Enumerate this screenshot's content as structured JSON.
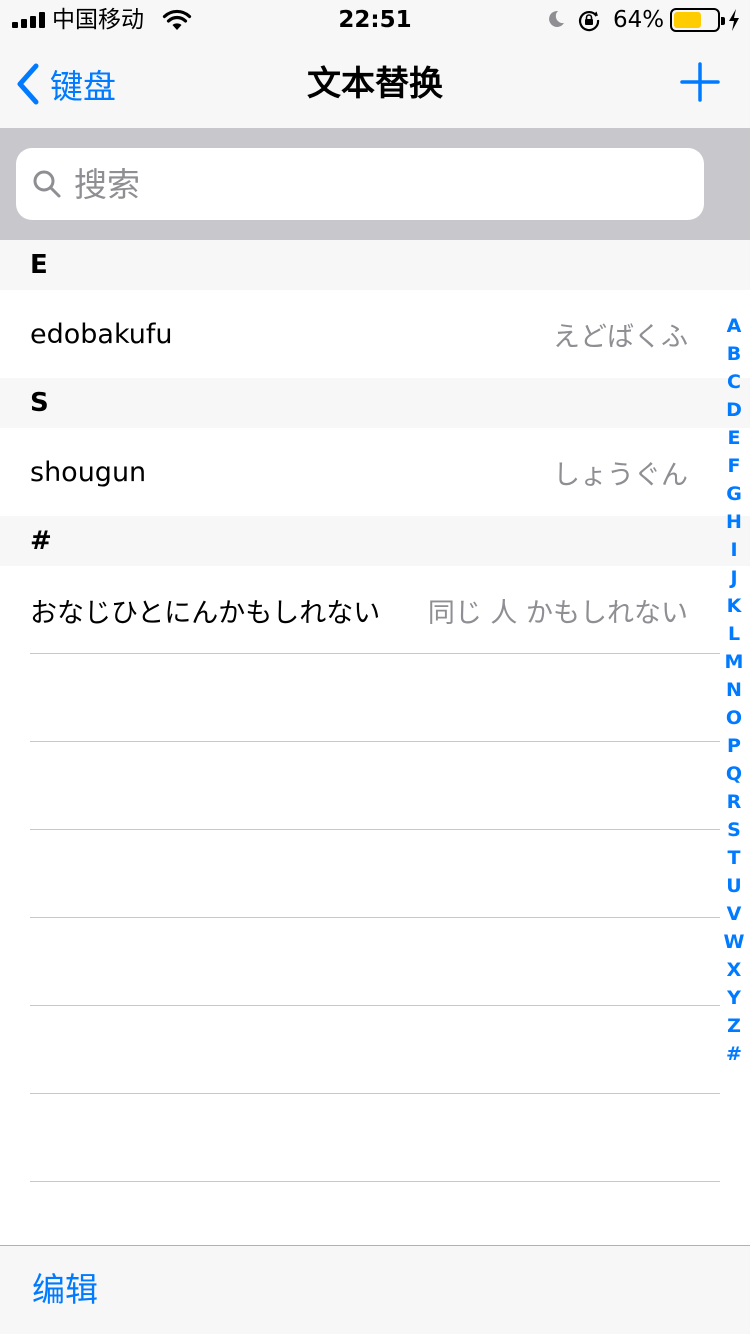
{
  "status_bar": {
    "carrier": "中国移动",
    "time": "22:51",
    "battery_percent": "64%",
    "battery_level": 0.64,
    "icons": [
      "signal-icon",
      "wifi-icon",
      "moon-icon",
      "orientation-lock-icon",
      "battery-icon",
      "charging-bolt-icon"
    ]
  },
  "nav": {
    "back_label": "键盘",
    "title": "文本替换",
    "add_icon": "plus-icon"
  },
  "search": {
    "placeholder": "搜索",
    "value": ""
  },
  "sections": [
    {
      "header": "E",
      "rows": [
        {
          "phrase": "edobakufu",
          "shortcut": "えどばくふ"
        }
      ]
    },
    {
      "header": "S",
      "rows": [
        {
          "phrase": "shougun",
          "shortcut": "しょうぐん"
        }
      ]
    },
    {
      "header": "#",
      "rows": [
        {
          "phrase": "おなじひとにんかもしれない",
          "shortcut": "同じ 人 かもしれない"
        }
      ]
    }
  ],
  "index": [
    "A",
    "B",
    "C",
    "D",
    "E",
    "F",
    "G",
    "H",
    "I",
    "J",
    "K",
    "L",
    "M",
    "N",
    "O",
    "P",
    "Q",
    "R",
    "S",
    "T",
    "U",
    "V",
    "W",
    "X",
    "Y",
    "Z",
    "#"
  ],
  "toolbar": {
    "edit_label": "编辑"
  },
  "colors": {
    "accent": "#007aff",
    "secondary_text": "#8e8e93",
    "separator": "#c8c7cc",
    "bar_background": "#f7f7f7",
    "battery": "#ffcc00"
  }
}
